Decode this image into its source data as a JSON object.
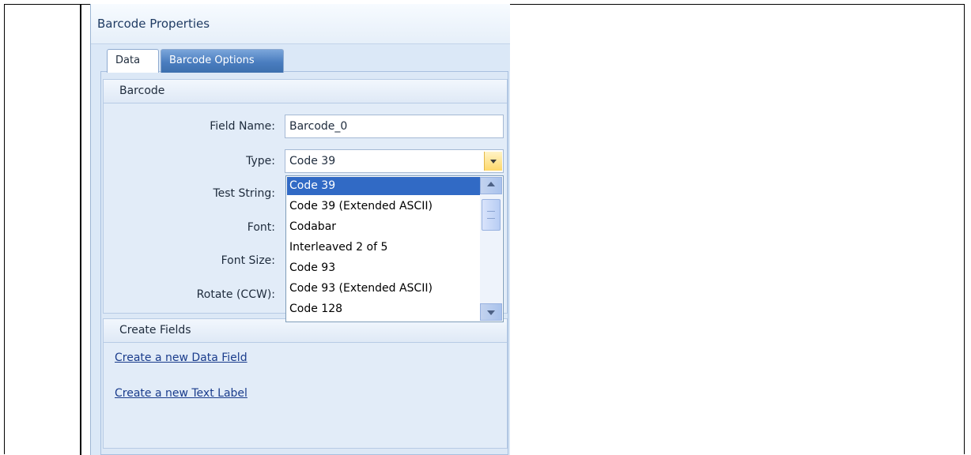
{
  "panel": {
    "title": "Barcode Properties"
  },
  "tabs": [
    {
      "label": "Data",
      "active": true
    },
    {
      "label": "Barcode Options",
      "active": false
    }
  ],
  "barcode_group": {
    "header": "Barcode",
    "fields": {
      "field_name": {
        "label": "Field Name:",
        "value": "Barcode_0"
      },
      "type": {
        "label": "Type:",
        "value": "Code 39"
      },
      "test_string": {
        "label": "Test String:"
      },
      "font": {
        "label": "Font:"
      },
      "font_size": {
        "label": "Font Size:"
      },
      "rotate": {
        "label": "Rotate (CCW):"
      }
    }
  },
  "type_dropdown": {
    "options": [
      "Code 39",
      "Code 39 (Extended ASCII)",
      "Codabar",
      "Interleaved 2 of 5",
      "Code 93",
      "Code 93 (Extended ASCII)",
      "Code 128"
    ],
    "selected": "Code 39"
  },
  "create_group": {
    "header": "Create Fields",
    "links": [
      "Create a new Data Field",
      "Create a new Text Label"
    ]
  },
  "colors": {
    "panel_bg": "#dbe8f7",
    "selection": "#316ac5",
    "link": "#1a3c8c",
    "active_tab_bg": "#4a7dbf"
  }
}
